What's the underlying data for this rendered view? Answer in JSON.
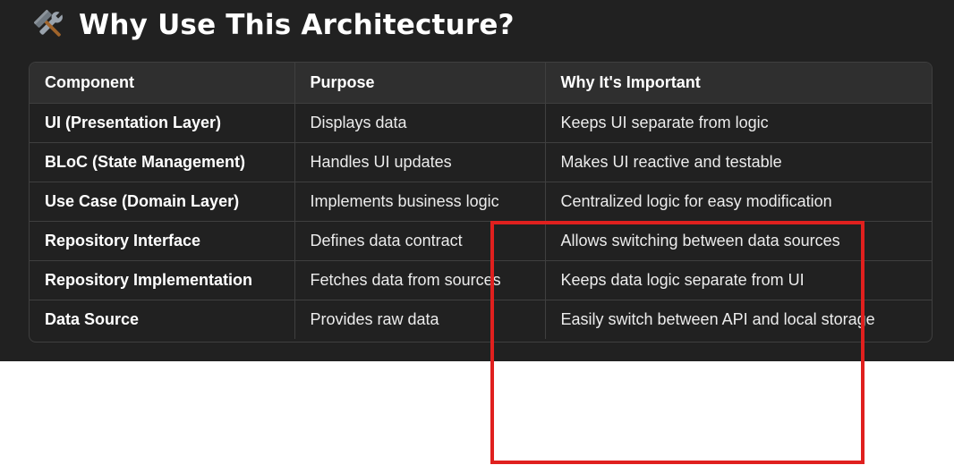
{
  "heading": {
    "icon": "hammer-and-wrench-icon",
    "title": "Why Use This Architecture?"
  },
  "table": {
    "headers": [
      "Component",
      "Purpose",
      "Why It's Important"
    ],
    "rows": [
      [
        "UI (Presentation Layer)",
        "Displays data",
        "Keeps UI separate from logic"
      ],
      [
        "BLoC (State Management)",
        "Handles UI updates",
        "Makes UI reactive and testable"
      ],
      [
        "Use Case (Domain Layer)",
        "Implements business logic",
        "Centralized logic for easy modification"
      ],
      [
        "Repository Interface",
        "Defines data contract",
        "Allows switching between data sources"
      ],
      [
        "Repository Implementation",
        "Fetches data from sources",
        "Keeps data logic separate from UI"
      ],
      [
        "Data Source",
        "Provides raw data",
        "Easily switch between API and local storage"
      ]
    ]
  },
  "colors": {
    "panel_background": "#212121",
    "header_background": "#2f2f2f",
    "border": "#3f3f3f",
    "annotation": "#e0201e"
  }
}
